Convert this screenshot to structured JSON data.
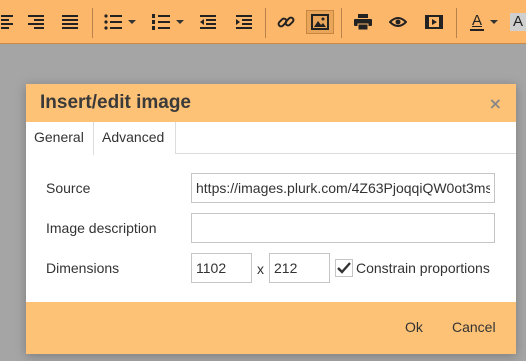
{
  "toolbar": {
    "buttons": [
      {
        "icon": "align-center-icon"
      },
      {
        "icon": "align-right-icon"
      },
      {
        "icon": "align-justify-icon"
      },
      {
        "icon": "bullet-list-icon"
      },
      {
        "icon": "numbered-list-icon"
      },
      {
        "icon": "outdent-icon"
      },
      {
        "icon": "indent-icon"
      },
      {
        "icon": "link-icon"
      },
      {
        "icon": "image-icon"
      },
      {
        "icon": "print-icon"
      },
      {
        "icon": "preview-icon"
      },
      {
        "icon": "media-icon"
      },
      {
        "icon": "text-color-icon"
      },
      {
        "icon": "background-color-icon"
      }
    ],
    "text_color_letter": "A",
    "bg_color_letter": "A",
    "accent": "#fdb76b"
  },
  "dialog": {
    "title": "Insert/edit image",
    "close_glyph": "×",
    "tabs": [
      {
        "label": "General",
        "active": true
      },
      {
        "label": "Advanced",
        "active": false
      }
    ],
    "fields": {
      "source_label": "Source",
      "source_value": "https://images.plurk.com/4Z63PjoqqiQW0ot3ms",
      "description_label": "Image description",
      "description_value": "",
      "dimensions_label": "Dimensions",
      "width_value": "1102",
      "times": "x",
      "height_value": "212",
      "constrain_label": "Constrain proportions",
      "constrain_checked": true
    },
    "footer": {
      "ok_label": "Ok",
      "cancel_label": "Cancel"
    },
    "header_color": "#fdc276"
  }
}
